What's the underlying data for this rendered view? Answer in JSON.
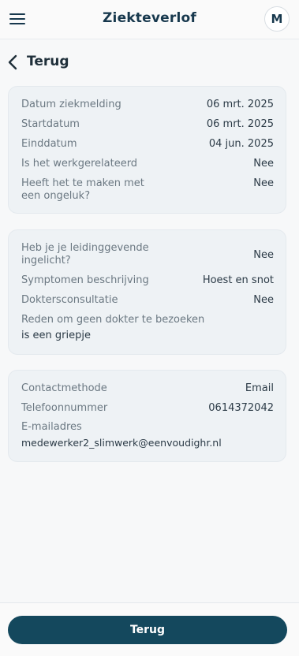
{
  "header": {
    "title": "Ziekteverlof",
    "avatar_initial": "M"
  },
  "back": {
    "label": "Terug"
  },
  "card1": {
    "rows": [
      {
        "label": "Datum ziekmelding",
        "value": "06 mrt. 2025"
      },
      {
        "label": "Startdatum",
        "value": "06 mrt. 2025"
      },
      {
        "label": "Einddatum",
        "value": "04 jun. 2025"
      },
      {
        "label": "Is het werkgerelateerd",
        "value": "Nee"
      },
      {
        "label": "Heeft het te maken met een ongeluk?",
        "value": "Nee"
      }
    ]
  },
  "card2": {
    "rows": [
      {
        "label": "Heb je je leidinggevende ingelicht?",
        "value": "Nee"
      },
      {
        "label": "Symptomen beschrijving",
        "value": "Hoest en snot"
      },
      {
        "label": "Doktersconsultatie",
        "value": "Nee"
      },
      {
        "label": "Reden om geen dokter te bezoeken",
        "value": "is een griepje"
      }
    ]
  },
  "card3": {
    "rows": [
      {
        "label": "Contactmethode",
        "value": "Email"
      },
      {
        "label": "Telefoonnummer",
        "value": "0614372042"
      },
      {
        "label": "E-mailadres",
        "value": "medewerker2_slimwerk@eenvoudighr.nl"
      }
    ]
  },
  "footer": {
    "button_label": "Terug"
  },
  "colors": {
    "primary": "#14485d",
    "card_bg": "#eef2f5",
    "label": "#6b7882"
  }
}
